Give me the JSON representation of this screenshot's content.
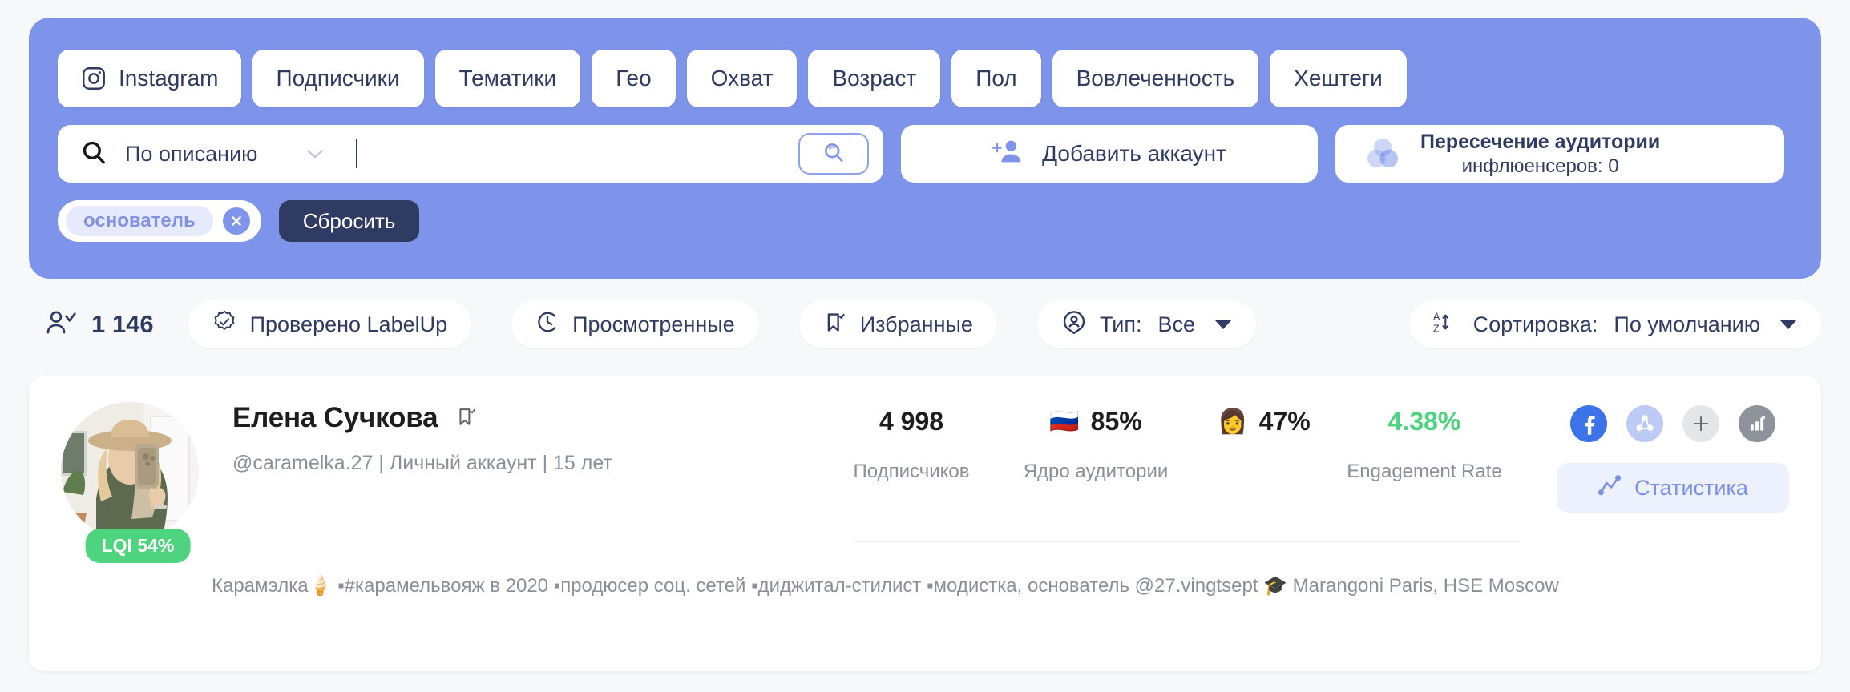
{
  "filters": {
    "chips": [
      {
        "label": "Instagram",
        "icon": "instagram-icon"
      },
      {
        "label": "Подписчики",
        "icon": null
      },
      {
        "label": "Тематики",
        "icon": null
      },
      {
        "label": "Гео",
        "icon": null
      },
      {
        "label": "Охват",
        "icon": null
      },
      {
        "label": "Возраст",
        "icon": null
      },
      {
        "label": "Пол",
        "icon": null
      },
      {
        "label": "Вовлеченность",
        "icon": null
      },
      {
        "label": "Хештеги",
        "icon": null
      }
    ]
  },
  "search": {
    "mode_label": "По описанию",
    "input_value": "",
    "input_placeholder": "",
    "search_icon": "search-icon",
    "submit_icon": "search-icon",
    "chevron_icon": "chevron-down-icon"
  },
  "add_account": {
    "label": "Добавить аккаунт",
    "icon": "add-person-icon"
  },
  "intersection": {
    "title": "Пересечение аудитории",
    "subtitle": "инфлюенсеров: 0",
    "icon": "venn-diagram-icon"
  },
  "tags": {
    "items": [
      {
        "label": "основатель",
        "remove_icon": "close-circle-icon"
      }
    ],
    "reset_label": "Сбросить"
  },
  "toolbar": {
    "count_icon": "person-check-icon",
    "count": "1 146",
    "verified_label": "Проверено LabelUp",
    "verified_icon": "verified-badge-icon",
    "viewed_label": "Просмотренные",
    "viewed_icon": "clock-icon",
    "favorites_label": "Избранные",
    "favorites_icon": "bookmark-check-icon",
    "type_label": "Тип:",
    "type_value": "Все",
    "type_icon": "account-pin-icon",
    "sort_label": "Сортировка:",
    "sort_value": "По умолчанию",
    "sort_icon": "sort-az-icon"
  },
  "profile": {
    "name": "Елена Сучкова",
    "bookmark_icon": "bookmark-check-icon",
    "meta": "@caramelka.27 | Личный аккаунт | 15 лет",
    "lqi_badge": "LQI 54%",
    "avatar_alt": "avatar",
    "bio": "Карамэлка🍦 ▪#карамельвояж в 2020 ▪продюсер соц. сетей ▪диджитал-стилист ▪модистка, основатель @27.vingtsept   🎓 Marangoni Paris, HSE Moscow",
    "stats": [
      {
        "value": "4 998",
        "label": "Подписчиков",
        "emoji": "",
        "color": "#1d1d1f"
      },
      {
        "value": "85%",
        "label": "Ядро аудитории",
        "emoji": "🇷🇺",
        "color": "#1d1d1f"
      },
      {
        "value": "47%",
        "label": "",
        "emoji": "👩",
        "color": "#1d1d1f"
      },
      {
        "value": "4.38%",
        "label": "Engagement Rate",
        "emoji": "",
        "color": "#4ed47f"
      }
    ],
    "actions": [
      {
        "name": "facebook-icon",
        "title": "Facebook"
      },
      {
        "name": "network-share-icon",
        "title": "Связи"
      },
      {
        "name": "plus-icon",
        "title": "Добавить"
      },
      {
        "name": "bar-chart-icon",
        "title": "Отчёт"
      }
    ],
    "stats_button_label": "Статистика",
    "stats_button_icon": "line-chart-icon"
  },
  "colors": {
    "panel_blue": "#7d94ea",
    "dark_navy": "#2f3b63",
    "accent_green": "#4ed47f",
    "muted_gray": "#8a8f9a",
    "page_bg": "#f7f8fa"
  }
}
